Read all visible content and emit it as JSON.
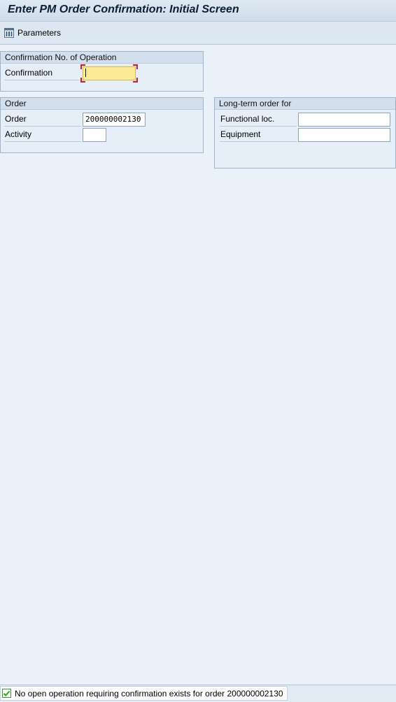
{
  "window": {
    "title": "Enter PM Order Confirmation: Initial Screen"
  },
  "toolbar": {
    "parameters_label": "Parameters",
    "parameters_icon": "parameters-icon"
  },
  "groups": {
    "confirmation": {
      "title": "Confirmation No. of Operation",
      "confirmation_label": "Confirmation",
      "confirmation_value": ""
    },
    "order": {
      "title": "Order",
      "order_label": "Order",
      "order_value": "200000002130",
      "activity_label": "Activity",
      "activity_value": ""
    },
    "long_term": {
      "title": "Long-term order for",
      "functional_loc_label": "Functional loc.",
      "functional_loc_value": "",
      "equipment_label": "Equipment",
      "equipment_value": ""
    }
  },
  "status": {
    "icon": "success-check-icon",
    "message": "No open operation requiring confirmation exists for order 200000002130"
  },
  "colors": {
    "background": "#eaf1f8",
    "focused_input": "#fdeb96",
    "focus_marker": "#c8202a",
    "success": "#2f9d27"
  }
}
